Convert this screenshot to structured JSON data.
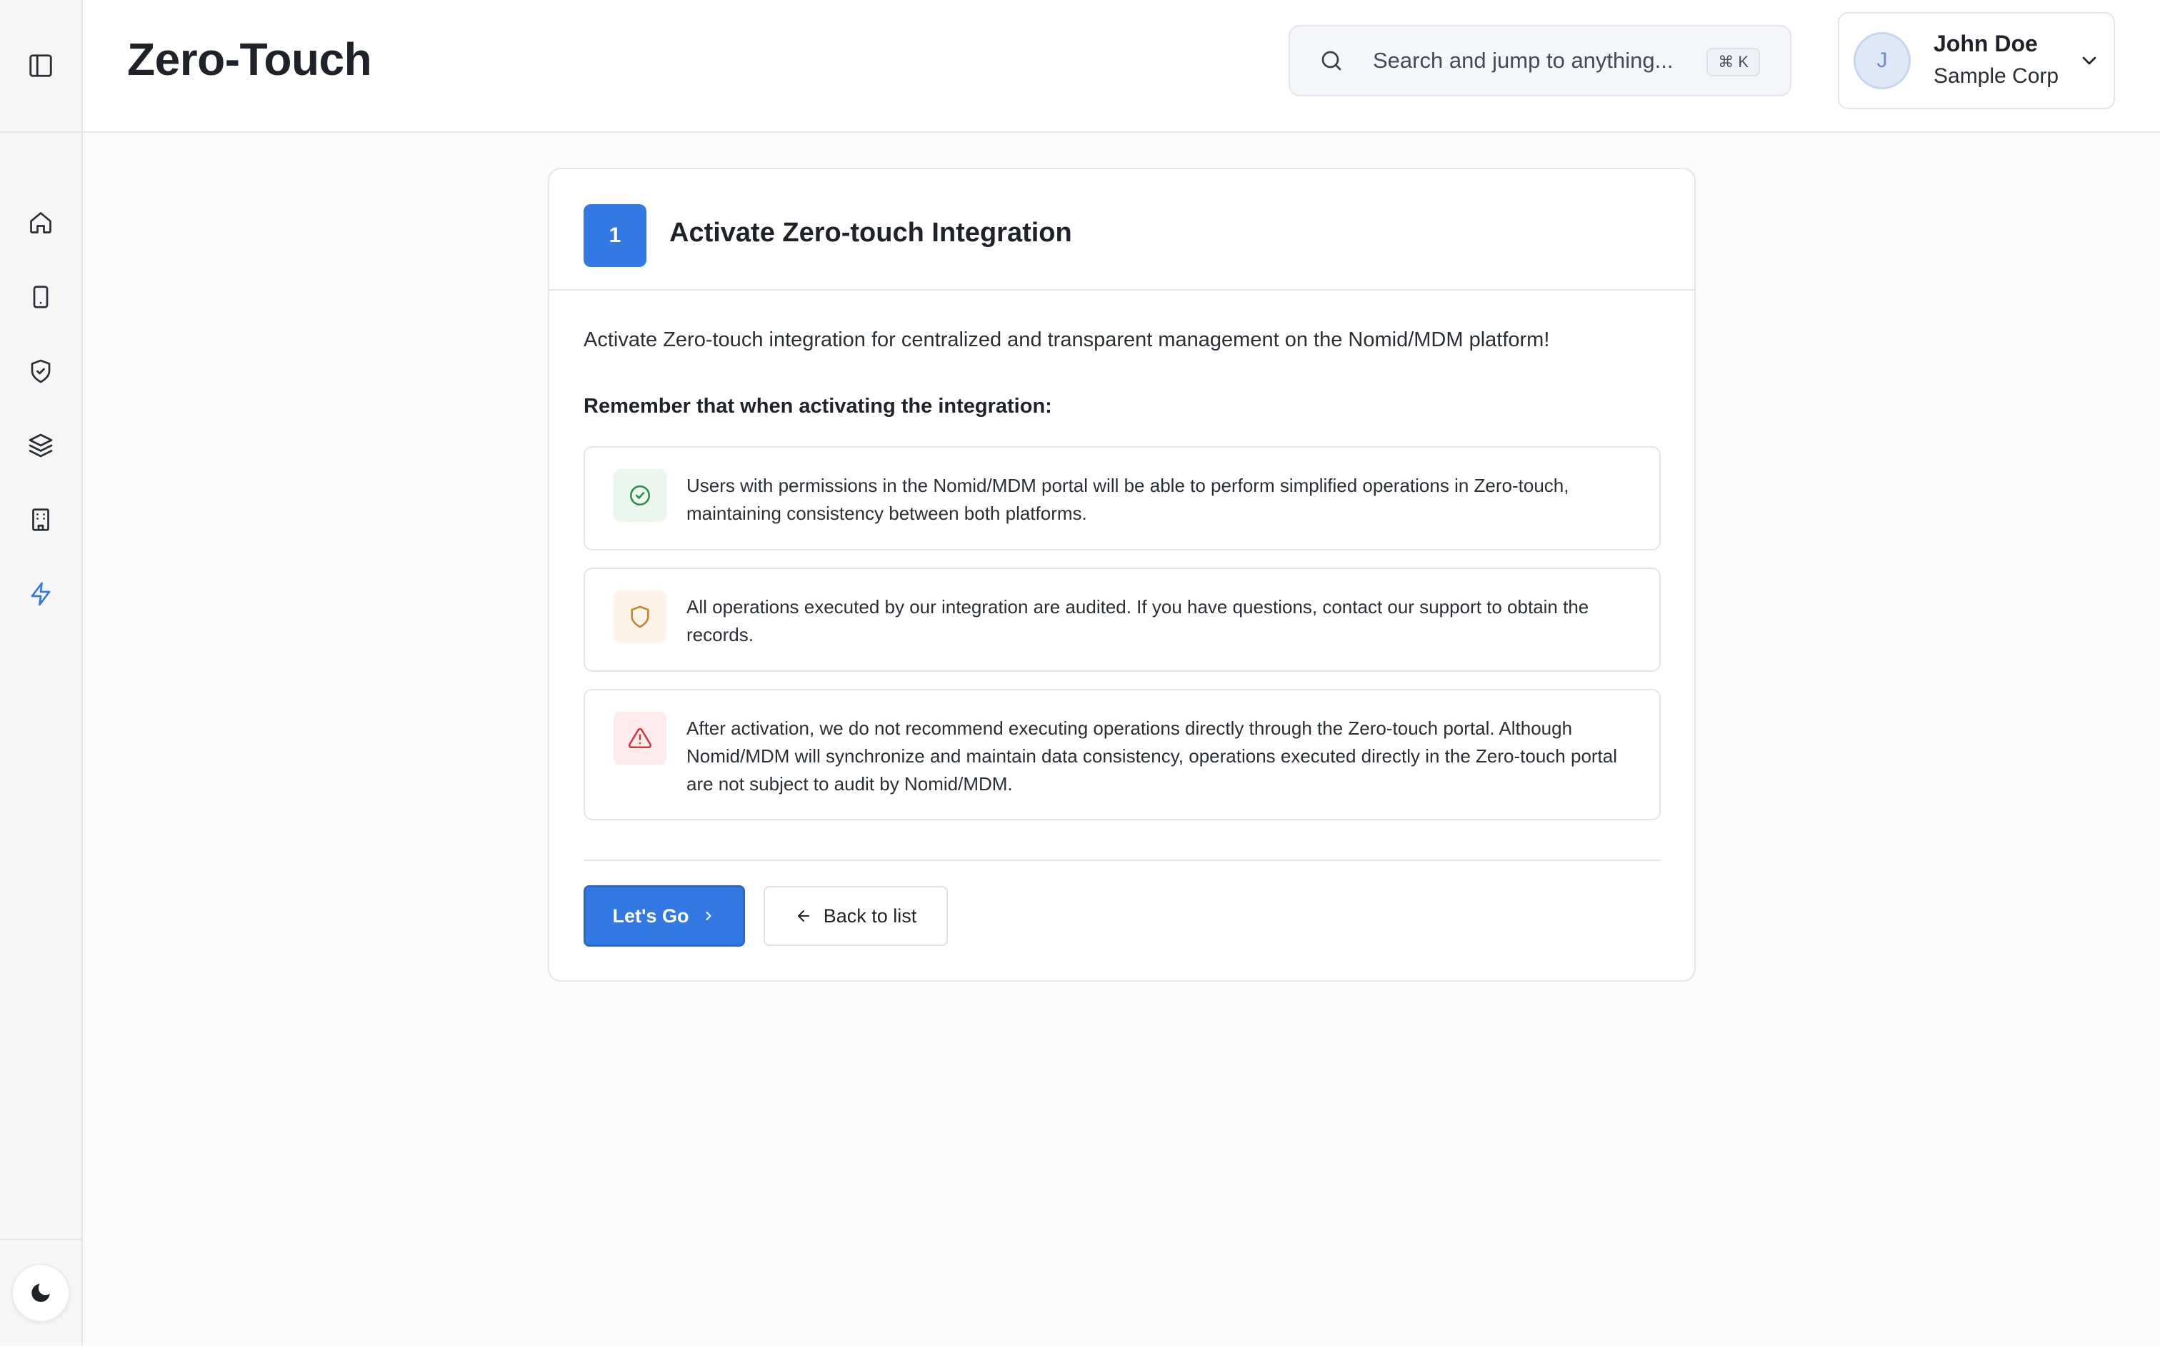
{
  "app": {
    "page_title": "Zero-Touch"
  },
  "sidebar": {
    "toggle_icon": "sidebar-panel-icon",
    "items": [
      {
        "name": "home",
        "icon": "home-icon",
        "active": false
      },
      {
        "name": "devices",
        "icon": "tablet-icon",
        "active": false
      },
      {
        "name": "security",
        "icon": "shield-check-icon",
        "active": false
      },
      {
        "name": "layers",
        "icon": "layers-icon",
        "active": false
      },
      {
        "name": "organization",
        "icon": "building-icon",
        "active": false
      },
      {
        "name": "zero-touch",
        "icon": "lightning-icon",
        "active": true
      }
    ],
    "theme_icon": "moon-icon"
  },
  "search": {
    "placeholder": "Search and jump to anything...",
    "shortcut": "⌘ K"
  },
  "user": {
    "initial": "J",
    "name": "John Doe",
    "org": "Sample Corp"
  },
  "card": {
    "step": "1",
    "title": "Activate Zero-touch Integration",
    "intro": "Activate Zero-touch integration for centralized and transparent management on the Nomid/MDM platform!",
    "remember": "Remember that when activating the integration:",
    "notices": [
      {
        "icon": "check-circle-icon",
        "text": "Users with permissions in the Nomid/MDM portal will be able to perform simplified operations in Zero-touch, maintaining consistency between both platforms."
      },
      {
        "icon": "shield-icon",
        "text": "All operations executed by our integration are audited. If you have questions, contact our support to obtain the records."
      },
      {
        "icon": "warning-triangle-icon",
        "text": "After activation, we do not recommend executing operations directly through the Zero-touch portal. Although Nomid/MDM will synchronize and maintain data consistency, operations executed directly in the Zero-touch portal are not subject to audit by Nomid/MDM."
      }
    ],
    "primary_button": "Let's Go",
    "secondary_button": "Back to list"
  },
  "colors": {
    "accent": "#3279e3",
    "success_bg": "#eaf6ee",
    "success": "#2e8b4a",
    "warn_bg": "#fdf3e6",
    "warn": "#c7832b",
    "danger_bg": "#fdebee",
    "danger": "#d0373f"
  }
}
